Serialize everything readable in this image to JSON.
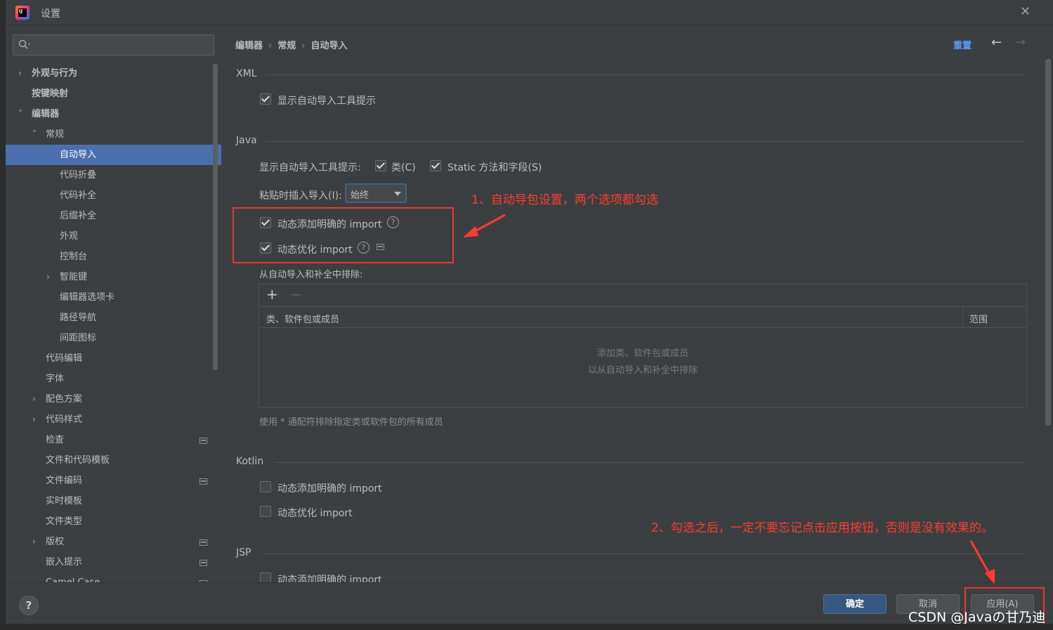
{
  "window": {
    "title": "设置",
    "app_icon": "intellij-idea-icon",
    "close_icon": "close-icon"
  },
  "sidebar": {
    "search_placeholder": "",
    "items": [
      {
        "label": "外观与行为",
        "arrow": "›",
        "bold": true
      },
      {
        "label": "按键映射",
        "arrow": "",
        "bold": true
      },
      {
        "label": "编辑器",
        "arrow": "˅",
        "bold": true
      },
      {
        "label": "常规",
        "arrow": "˅"
      },
      {
        "label": "自动导入",
        "selected": true
      },
      {
        "label": "代码折叠"
      },
      {
        "label": "代码补全"
      },
      {
        "label": "后缀补全"
      },
      {
        "label": "外观"
      },
      {
        "label": "控制台"
      },
      {
        "label": "智能键",
        "arrow": "›"
      },
      {
        "label": "编辑器选项卡"
      },
      {
        "label": "路径导航"
      },
      {
        "label": "间距图标"
      },
      {
        "label": "代码编辑"
      },
      {
        "label": "字体"
      },
      {
        "label": "配色方案",
        "arrow": "›"
      },
      {
        "label": "代码样式",
        "arrow": "›"
      },
      {
        "label": "检查",
        "mini": true
      },
      {
        "label": "文件和代码模板"
      },
      {
        "label": "文件编码",
        "mini": true
      },
      {
        "label": "实时模板"
      },
      {
        "label": "文件类型"
      },
      {
        "label": "版权",
        "arrow": "›",
        "mini": true
      },
      {
        "label": "嵌入提示",
        "mini": true
      },
      {
        "label": "Camel Case",
        "mini": true
      }
    ]
  },
  "breadcrumb": {
    "items": [
      "编辑器",
      "常规",
      "自动导入"
    ],
    "separator": "›"
  },
  "toolbar": {
    "reset_label": "重置",
    "back_icon": "←",
    "forward_icon": "→"
  },
  "xml": {
    "header": "XML",
    "show_popup": {
      "label": "显示自动导入工具提示",
      "checked": true
    }
  },
  "java": {
    "header": "Java",
    "show_popup_label": "显示自动导入工具提示:",
    "classes": {
      "label": "类(C)",
      "checked": true
    },
    "static": {
      "label": "Static 方法和字段(S)",
      "checked": true
    },
    "paste_label": "粘贴时插入导入(I):",
    "paste_value": "始终",
    "add_unambiguous": {
      "label": "动态添加明确的 import",
      "checked": true
    },
    "optimize": {
      "label": "动态优化 import",
      "checked": true
    },
    "exclude_label": "从自动导入和补全中排除:",
    "table": {
      "add": "+",
      "remove": "−",
      "col1": "类、软件包或成员",
      "col2": "范围",
      "empty_line1": "添加类、软件包或成员",
      "empty_line2": "以从自动导入和补全中排除"
    },
    "hint": "使用 * 通配符排除指定类或软件包的所有成员"
  },
  "kotlin": {
    "header": "Kotlin",
    "add_unambiguous": {
      "label": "动态添加明确的 import",
      "checked": false
    },
    "optimize": {
      "label": "动态优化 import",
      "checked": false
    }
  },
  "jsp": {
    "header": "JSP",
    "add_unambiguous": {
      "label": "动态添加明确的 import",
      "checked": false
    }
  },
  "annotations": {
    "note1": "1、自动导包设置，两个选项都勾选",
    "note2": "2、勾选之后，一定不要忘记点击应用按钮，否则是没有效果的。",
    "color": "#ff3b30"
  },
  "footer": {
    "help": "?",
    "ok": "确定",
    "cancel": "取消",
    "apply": "应用(A)"
  },
  "watermark": "CSDN @Javaの甘乃迪",
  "colors": {
    "accent": "#4b6eaf",
    "link": "#589df6",
    "primary_button": "#365880",
    "background": "#3c3f41"
  }
}
